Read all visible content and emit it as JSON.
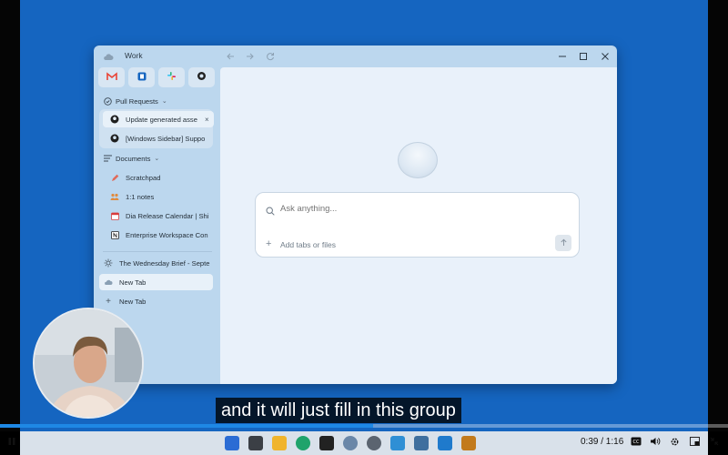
{
  "window": {
    "title": "Work",
    "app_tiles": [
      {
        "name": "gmail",
        "color": "#ea4335"
      },
      {
        "name": "blue-app",
        "color": "#1565c0"
      },
      {
        "name": "slack",
        "color": "#611f69"
      },
      {
        "name": "github",
        "color": "#222222"
      }
    ]
  },
  "sidebar": {
    "pull_requests": {
      "label": "Pull Requests",
      "items": [
        {
          "label": "Update generated asse",
          "icon": "github-icon"
        },
        {
          "label": "[Windows Sidebar] Suppo",
          "icon": "github-icon"
        }
      ]
    },
    "documents": {
      "label": "Documents",
      "items": [
        {
          "label": "Scratchpad",
          "icon": "pencil-icon"
        },
        {
          "label": "1:1 notes",
          "icon": "people-icon"
        },
        {
          "label": "Dia Release Calendar | Shi",
          "icon": "calendar-icon"
        },
        {
          "label": "Enterprise Workspace Con",
          "icon": "notion-icon"
        }
      ]
    },
    "tabs": [
      {
        "label": "The Wednesday Brief - Septe",
        "icon": "sun-icon"
      },
      {
        "label": "New Tab",
        "icon": "cloud-icon",
        "active": true
      },
      {
        "label": "New Tab",
        "icon": "plus-icon"
      }
    ]
  },
  "search": {
    "placeholder": "Ask anything...",
    "add_label": "Add tabs or files"
  },
  "subtitle": "and it will just fill in this group",
  "player": {
    "time": "0:39 / 1:16",
    "progress": 0.513
  }
}
